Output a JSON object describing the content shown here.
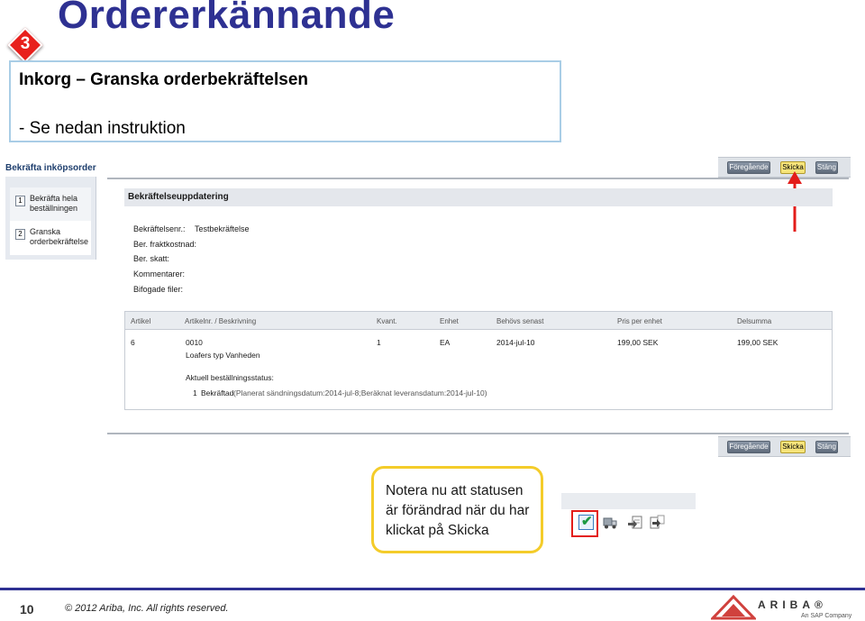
{
  "slide": {
    "title": "Ordererkännande",
    "step_number": "3",
    "instruction_title": "Inkorg –  Granska orderbekräftelsen",
    "instruction_line": "-  Se nedan instruktion"
  },
  "app": {
    "page_label": "Bekräfta inköpsorder",
    "nav": [
      {
        "num": "1",
        "label_line1": "Bekräfta hela",
        "label_line2": "beställningen"
      },
      {
        "num": "2",
        "label_line1": "Granska",
        "label_line2": "orderbekräftelse"
      }
    ],
    "toolbar": {
      "prev": "Föregående",
      "send": "Skicka",
      "close": "Stäng"
    },
    "section_title": "Bekräftelseuppdatering",
    "fields": [
      {
        "label": "Bekräftelsenr.:",
        "value": "Testbekräftelse"
      },
      {
        "label": "Ber. fraktkostnad:",
        "value": ""
      },
      {
        "label": "Ber. skatt:",
        "value": ""
      },
      {
        "label": "Kommentarer:",
        "value": ""
      },
      {
        "label": "Bifogade filer:",
        "value": ""
      }
    ],
    "table": {
      "headers": [
        "Artikel",
        "Artikelnr. / Beskrivning",
        "Kvant.",
        "Enhet",
        "Behövs senast",
        "Pris per enhet",
        "Delsumma"
      ],
      "row": {
        "artikel": "6",
        "artikelnr": "0010",
        "beskrivning": "Loafers typ Vanheden",
        "kvant": "1",
        "enhet": "EA",
        "behovs_senast": "2014-jul-10",
        "pris": "199,00 SEK",
        "delsumma": "199,00 SEK"
      },
      "status_label": "Aktuell beställningsstatus:",
      "status_qty": "1",
      "status_value": "Bekräftad",
      "status_detail": "(Planerat sändningsdatum:2014-jul-8;Beräknat leveransdatum:2014-jul-10)"
    }
  },
  "callout": {
    "line1": "Notera nu att statusen",
    "line2": "är förändrad när du har",
    "line3": "klickat på Skicka"
  },
  "icons": [
    "confirmed-check-icon",
    "truck-icon",
    "doc-arrow-in-icon",
    "doc-arrow-out-icon"
  ],
  "footer": {
    "page": "10",
    "copyright": "© 2012 Ariba, Inc. All rights reserved.",
    "logo_word": "ARIBA®",
    "logo_sub": "An SAP Company"
  },
  "colors": {
    "title": "#2e3192",
    "accent_red": "#e31d1a",
    "callout_border": "#f4cc2a",
    "send_button": "#f7e47a"
  }
}
